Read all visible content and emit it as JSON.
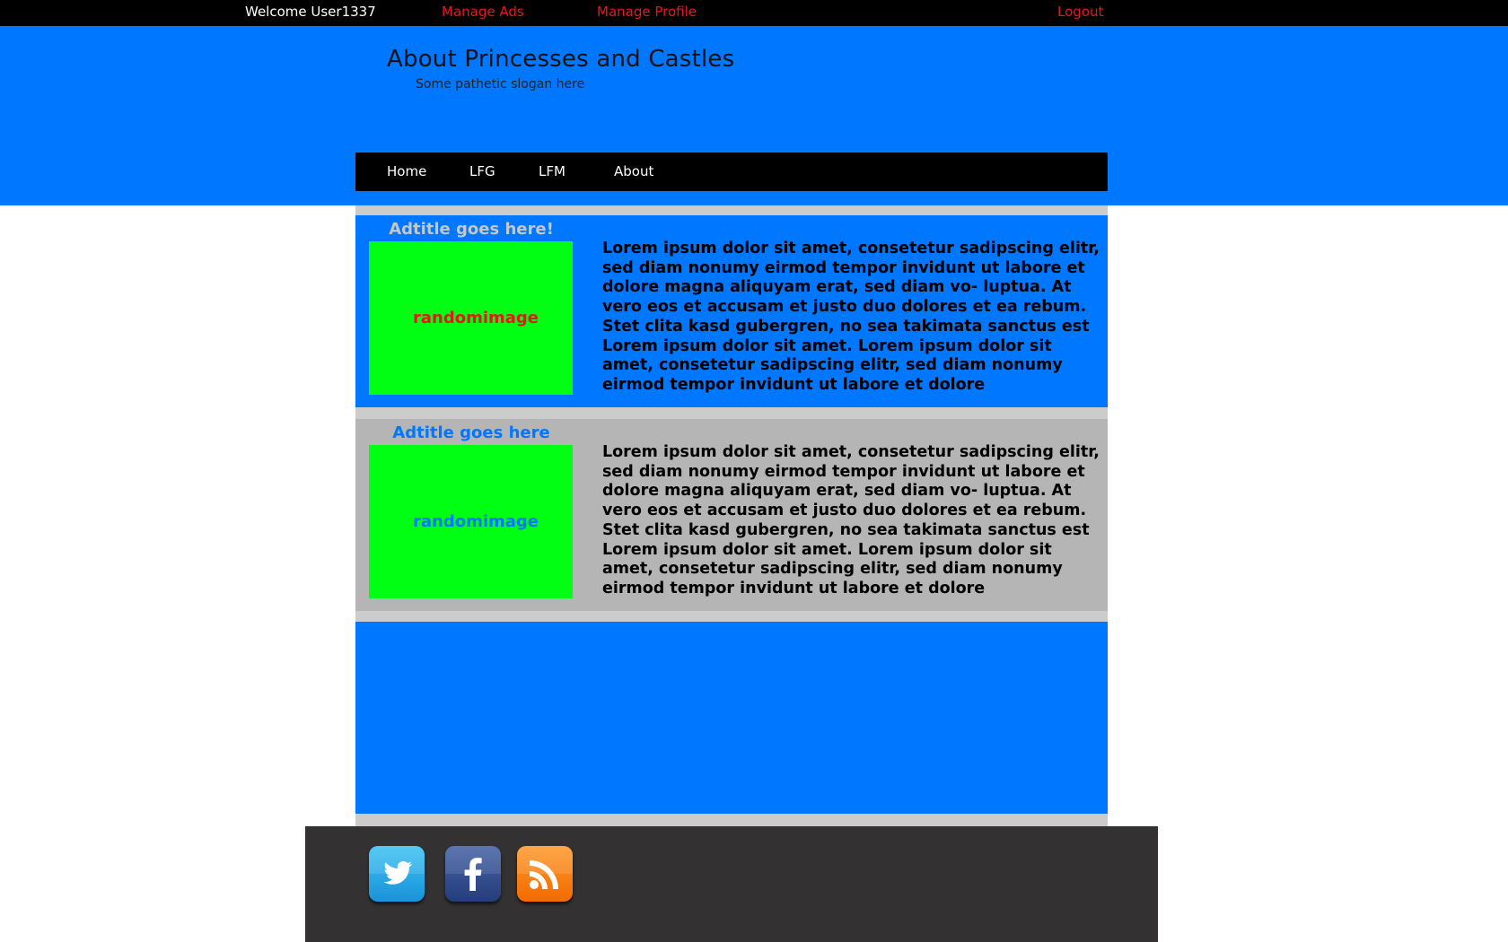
{
  "topbar": {
    "welcome": "Welcome User1337",
    "manage_ads": "Manage Ads",
    "manage_profile": "Manage Profile",
    "logout": "Logout"
  },
  "header": {
    "title": "About Princesses and Castles",
    "slogan": "Some pathetic slogan here"
  },
  "nav": {
    "items": [
      {
        "label": "Home"
      },
      {
        "label": "LFG"
      },
      {
        "label": "LFM"
      },
      {
        "label": "About"
      }
    ]
  },
  "ads": [
    {
      "title": "Adtitle goes here!",
      "image_label": "randomimage",
      "text": "Lorem ipsum dolor sit amet, consetetur sadipscing elitr, sed diam nonumy eirmod tempor invidunt ut labore et dolore magna aliquyam erat, sed diam vo- luptua. At vero eos et accusam et justo duo dolores et ea rebum. Stet clita kasd gubergren, no sea takimata sanctus est Lorem ipsum dolor sit amet. Lorem ipsum dolor sit amet, consetetur sadipscing elitr, sed diam nonumy eirmod tempor invidunt ut labore et dolore"
    },
    {
      "title": "Adtitle goes here",
      "image_label": "randomimage",
      "text": "Lorem ipsum dolor sit amet, consetetur sadipscing elitr, sed diam nonumy eirmod tempor invidunt ut labore et dolore magna aliquyam erat, sed diam vo- luptua. At vero eos et accusam et justo duo dolores et ea rebum. Stet clita kasd gubergren, no sea takimata sanctus est Lorem ipsum dolor sit amet. Lorem ipsum dolor sit amet, consetetur sadipscing elitr, sed diam nonumy eirmod tempor invidunt ut labore et dolore"
    }
  ],
  "footer": {
    "social_icons": [
      "twitter-icon",
      "facebook-icon",
      "rss-icon"
    ]
  },
  "colors": {
    "header_blue": "#0077ff",
    "link_red": "#e8161c",
    "image_green": "#00ff13",
    "ad_gray": "#b5b5b5",
    "footer_dark": "#333132"
  }
}
